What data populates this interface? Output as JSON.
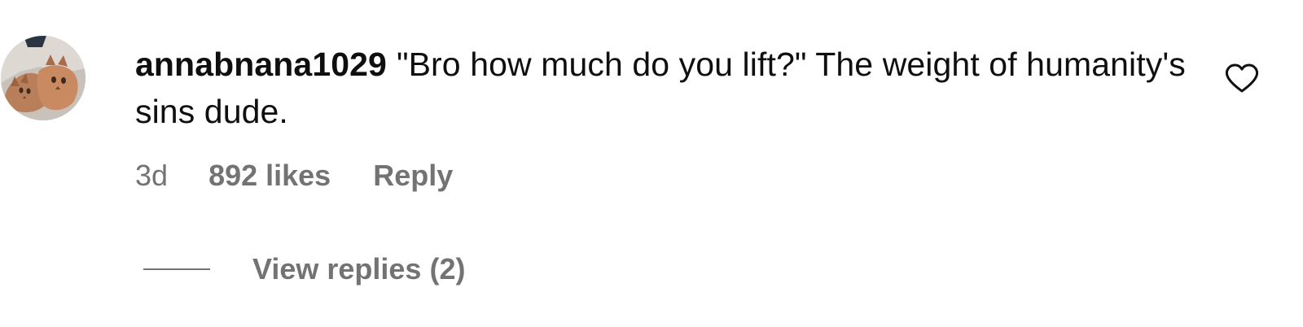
{
  "comment": {
    "username": "annabnana1029",
    "text": "\"Bro how much do you lift?\" The weight of humanity's sins dude.",
    "time": "3d",
    "likes": "892 likes",
    "reply_label": "Reply",
    "view_replies_label": "View replies (2)"
  },
  "icons": {
    "like": "heart-outline-icon",
    "avatar": "user-avatar"
  },
  "colors": {
    "text_primary": "#0f0f0f",
    "text_secondary": "#737373",
    "background": "#ffffff"
  }
}
